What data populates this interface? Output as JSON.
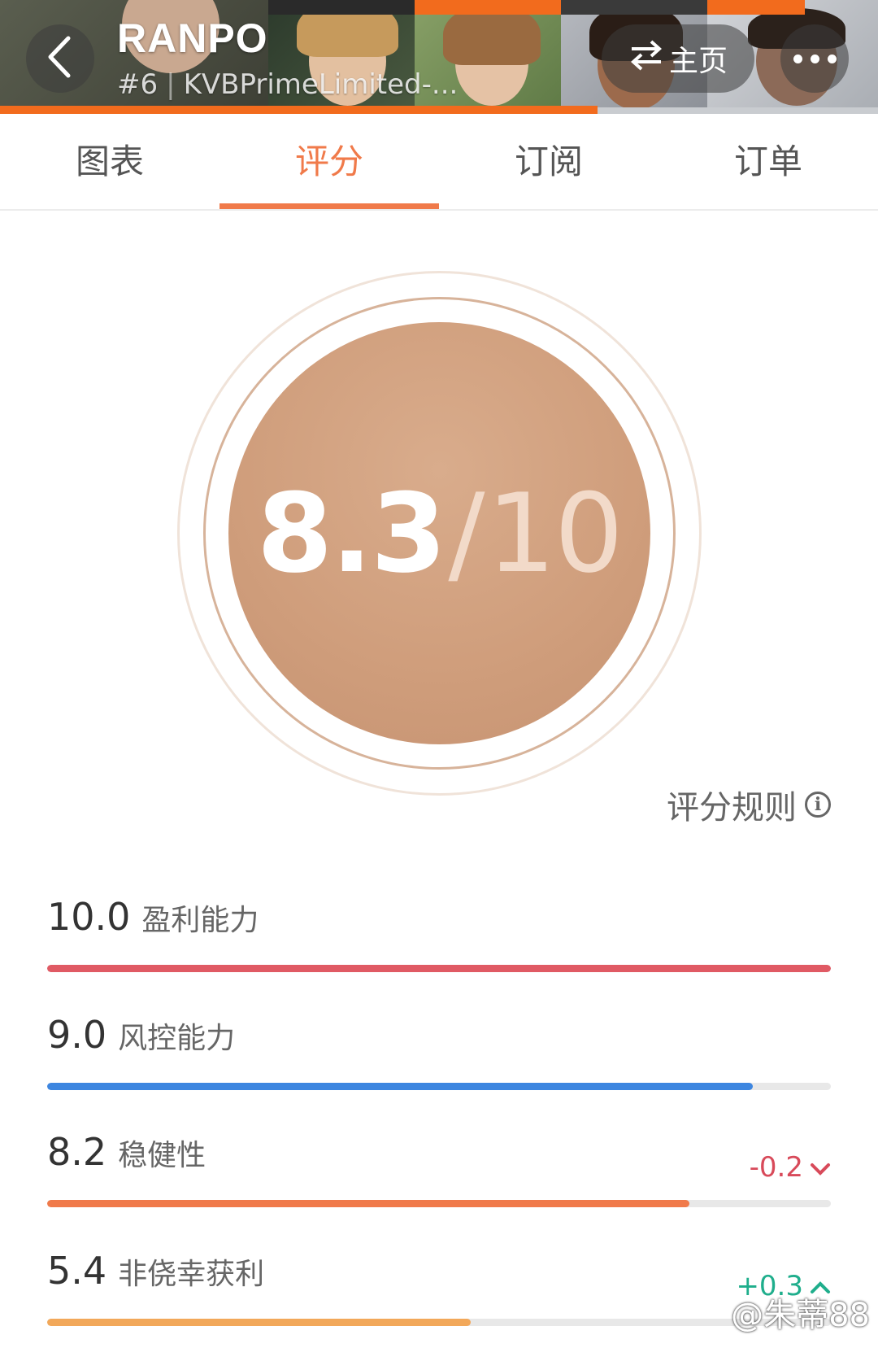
{
  "header": {
    "title": "RANPO",
    "rank": "#6",
    "broker": "KVBPrimeLimited-...",
    "home_label": "主页",
    "icons": {
      "back": "chevron-left-icon",
      "swap": "swap-arrows-icon",
      "more": "more-dots-icon"
    }
  },
  "tabs": [
    {
      "label": "图表",
      "active": false
    },
    {
      "label": "评分",
      "active": true
    },
    {
      "label": "订阅",
      "active": false
    },
    {
      "label": "订单",
      "active": false
    }
  ],
  "score": {
    "value": "8.3",
    "slash": "/",
    "max": "10"
  },
  "rules_label": "评分规则",
  "metrics": [
    {
      "value": "10.0",
      "label": "盈利能力",
      "fill": 1.0,
      "color": "#e05a64",
      "delta": ""
    },
    {
      "value": "9.0",
      "label": "风控能力",
      "fill": 0.9,
      "color": "#3d86e0",
      "delta": ""
    },
    {
      "value": "8.2",
      "label": "稳健性",
      "fill": 0.82,
      "color": "#f07a4a",
      "delta": "-0.2",
      "delta_dir": "down",
      "delta_color": "#d84a5a"
    },
    {
      "value": "5.4",
      "label": "非侥幸获利",
      "fill": 0.54,
      "color": "#f2a85a",
      "delta": "+0.3",
      "delta_dir": "up",
      "delta_color": "#1fae8c"
    }
  ],
  "watermark": "@朱蒂88",
  "colors": {
    "accent": "#f07a4a",
    "score_disc": "#cf9d7b",
    "header_orange": "#f26b1d"
  }
}
